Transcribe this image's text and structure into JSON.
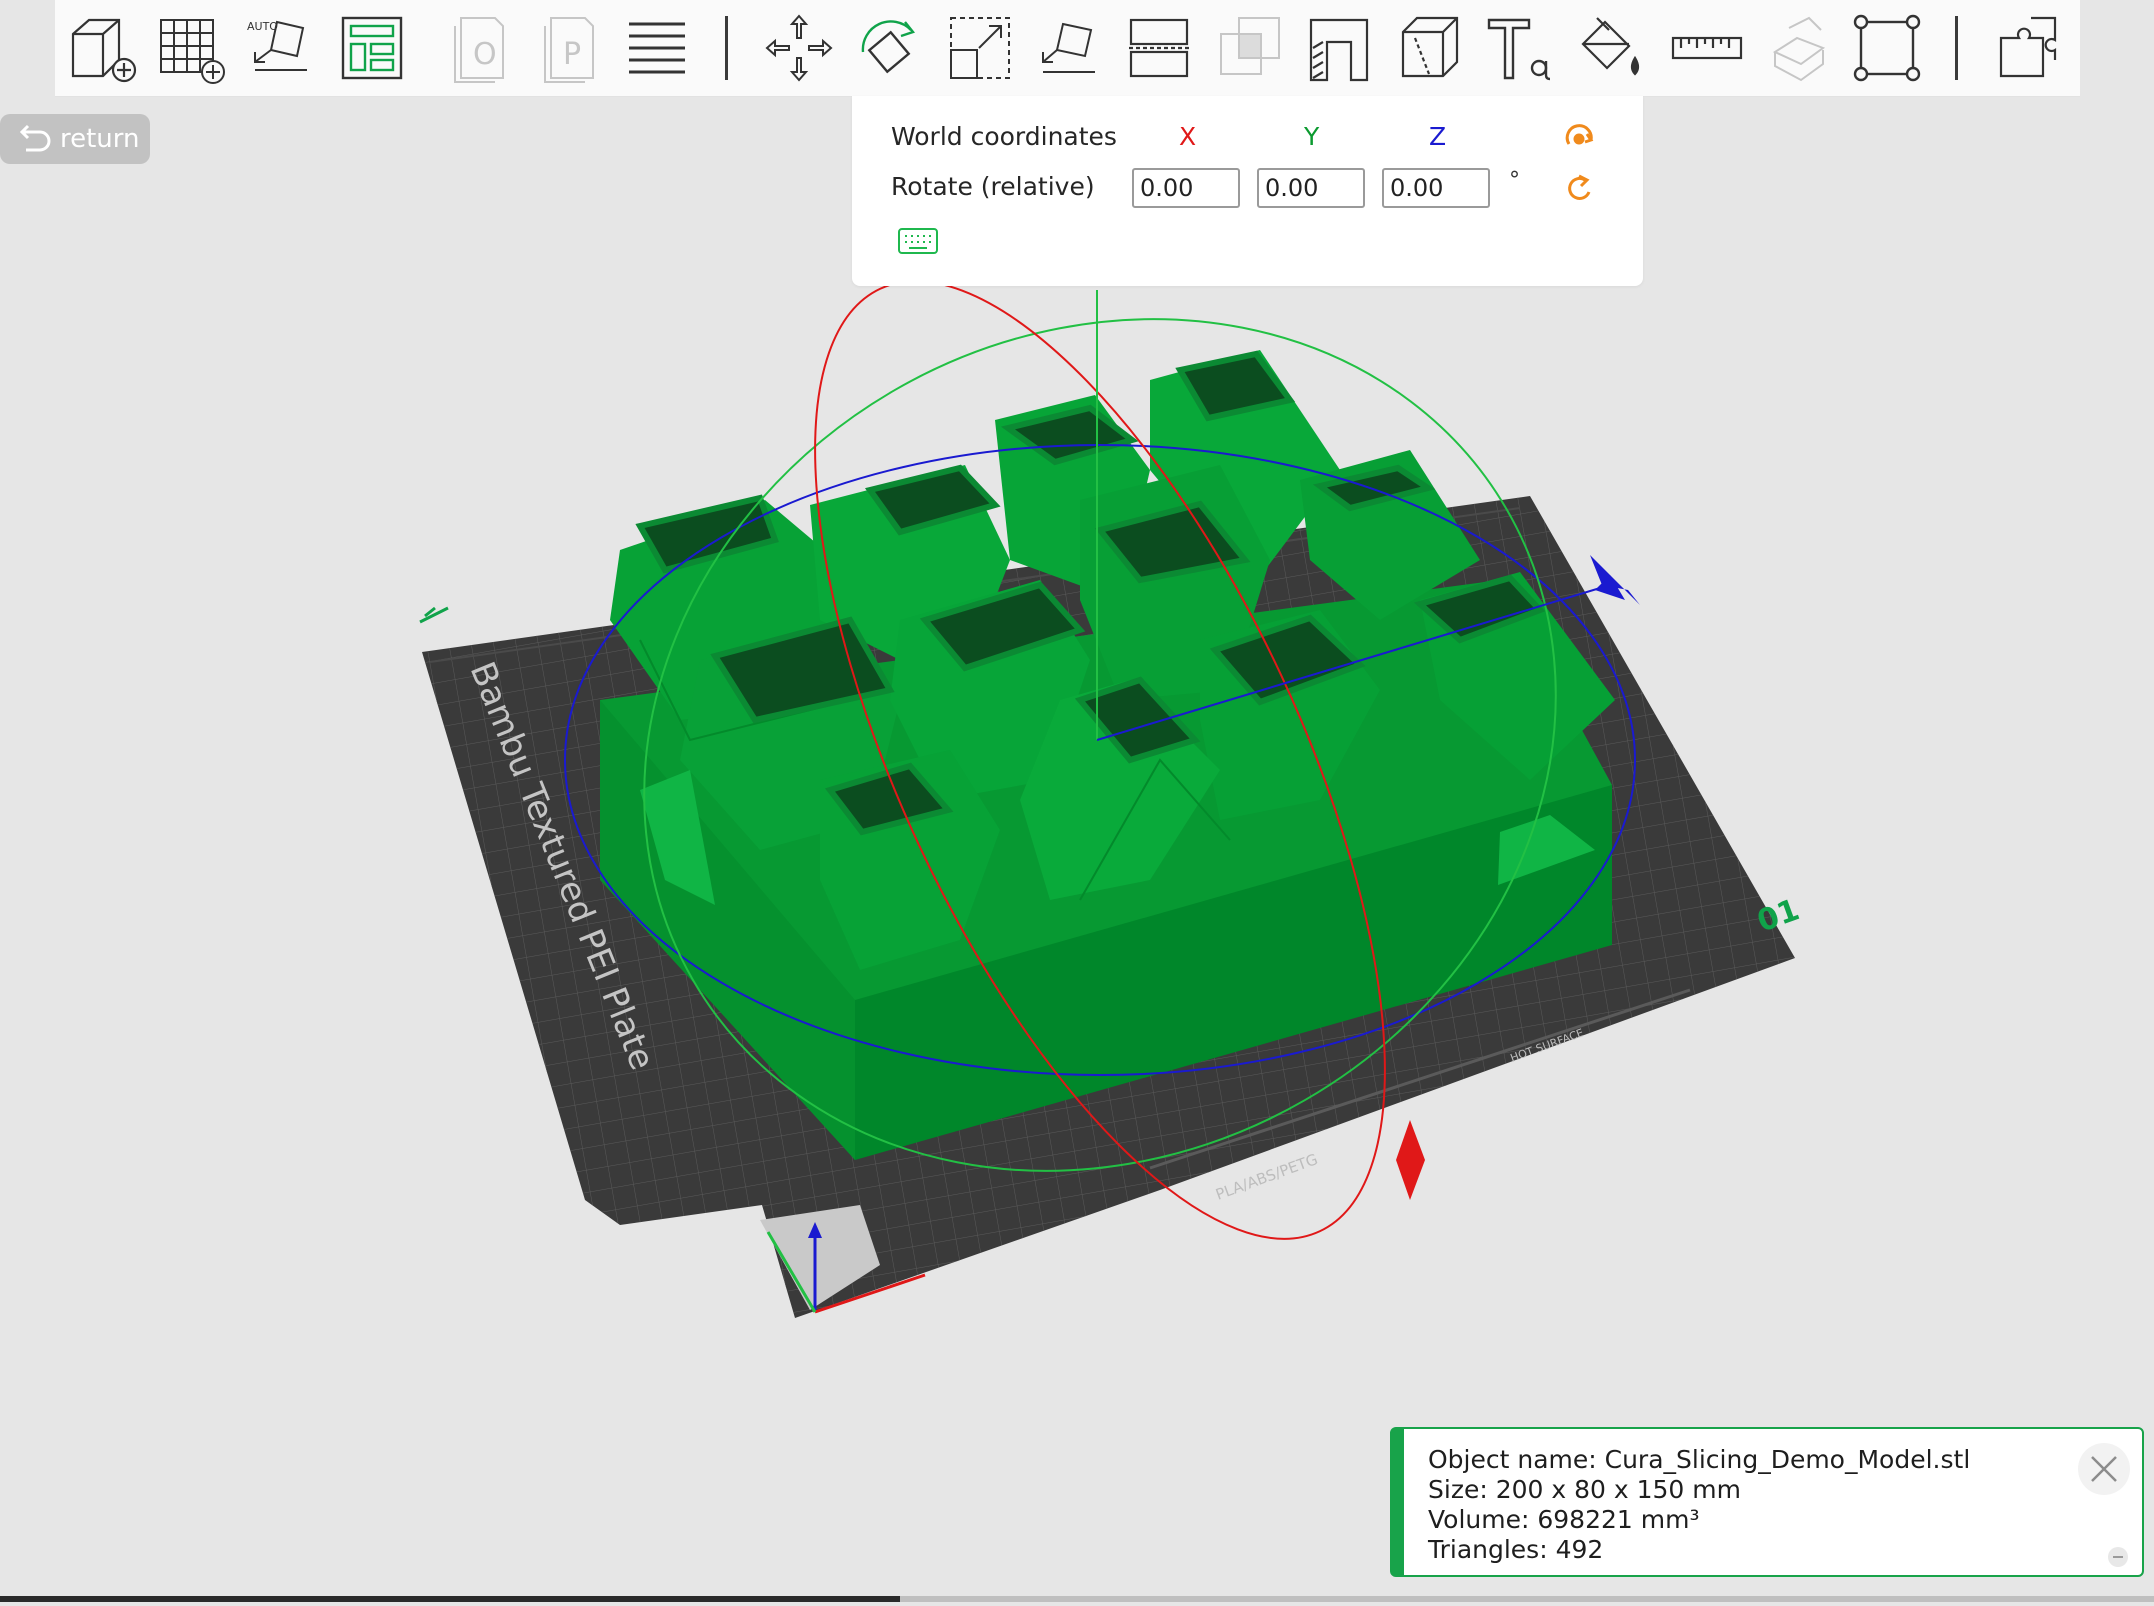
{
  "toolbar": {
    "tools": [
      {
        "name": "add-object-icon"
      },
      {
        "name": "add-plate-icon"
      },
      {
        "name": "auto-orient-icon",
        "label": "AUTO"
      },
      {
        "name": "arrange-icon"
      },
      {
        "name": "split-to-objects-icon",
        "label": "O"
      },
      {
        "name": "split-to-parts-icon",
        "label": "P"
      },
      {
        "name": "layers-icon"
      },
      {
        "name": "move-icon"
      },
      {
        "name": "rotate-icon"
      },
      {
        "name": "scale-icon"
      },
      {
        "name": "lay-on-face-icon"
      },
      {
        "name": "cut-icon"
      },
      {
        "name": "boolean-icon"
      },
      {
        "name": "support-painting-icon"
      },
      {
        "name": "seam-painting-icon"
      },
      {
        "name": "text-icon"
      },
      {
        "name": "color-painting-icon"
      },
      {
        "name": "measure-icon"
      },
      {
        "name": "assembly-icon"
      },
      {
        "name": "fit-view-icon"
      },
      {
        "name": "assemble-view-icon"
      }
    ]
  },
  "return_button": {
    "label": "return"
  },
  "rotate_panel": {
    "world_coordinates_label": "World coordinates",
    "rotate_label": "Rotate (relative)",
    "axis_x": "X",
    "axis_y": "Y",
    "axis_z": "Z",
    "x_value": "0.00",
    "y_value": "0.00",
    "z_value": "0.00",
    "unit": "°"
  },
  "plate": {
    "name": "Bambu Textured PEI Plate",
    "material_label": "PLA/ABS/PETG",
    "hot_surface_label": "HOT SURFACE",
    "plate_number": "01"
  },
  "info": {
    "object_name": "Object name: Cura_Slicing_Demo_Model.stl",
    "size": "Size: 200 x 80 x 150 mm",
    "volume": "Volume: 698221 mm³",
    "triangles": "Triangles: 492"
  },
  "colors": {
    "axis_x": "#e01818",
    "axis_y": "#0b9a2f",
    "axis_z": "#1a1ad0",
    "model_green": "#00a33a",
    "plate_dark": "#3c3c3c",
    "accent_orange": "#f08a1c",
    "panel_border": "#18a34a"
  }
}
